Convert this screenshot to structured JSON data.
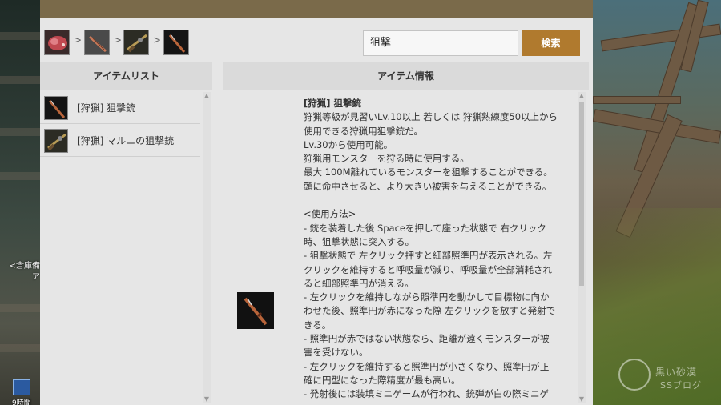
{
  "hud": {
    "side_text": "<倉庫備 ア",
    "time_text": "9時間"
  },
  "watermark": {
    "line1": "黒い砂漠",
    "line2": "SSブログ"
  },
  "breadcrumb": {
    "items": [
      {
        "icon": "meat-icon"
      },
      {
        "icon": "rifle-category-icon"
      },
      {
        "icon": "marni-rifle-icon"
      },
      {
        "icon": "sniper-rifle-icon"
      }
    ],
    "separator": ">"
  },
  "search": {
    "value": "狙撃",
    "button_label": "検索"
  },
  "list_panel": {
    "header": "アイテムリスト",
    "items": [
      {
        "label": "[狩猟] 狙撃銃",
        "icon": "sniper-rifle-icon"
      },
      {
        "label": "[狩猟] マルニの狙撃銃",
        "icon": "marni-rifle-icon"
      }
    ]
  },
  "info_panel": {
    "header": "アイテム情報",
    "title": "[狩猟] 狙撃銃",
    "lines": [
      "狩猟等級が見習いLv.10以上 若しくは 狩猟熟練度50以上から",
      "使用できる狩猟用狙撃銃だ。",
      "Lv.30から使用可能。",
      "狩猟用モンスターを狩る時に使用する。",
      "最大 100M離れているモンスターを狙撃することができる。",
      "頭に命中させると、より大きい被害を与えることができる。",
      "",
      "<使用方法>",
      "- 銃を装着した後 Spaceを押して座った状態で 右クリック",
      "時、狙撃状態に突入する。",
      "- 狙撃状態で 左クリック押すと細部照準円が表示される。左",
      "クリックを維持すると呼吸量が減り、呼吸量が全部消耗され",
      "ると細部照準円が消える。",
      "- 左クリックを維持しながら照準円を動かして目標物に向か",
      "わせた後、照準円が赤になった際 左クリックを放すと発射で",
      "きる。",
      "- 照準円が赤ではない状態なら、距離が遠くモンスターが被",
      "害を受けない。",
      "- 左クリックを維持すると照準円が小さくなり、照準円が正",
      "確に円型になった際精度が最も高い。",
      "- 発射後には装填ミニゲームが行われ、銃弾が白の際ミニゲ"
    ]
  },
  "colors": {
    "title_bar": "#7a6a4a",
    "accent_button": "#b07a2e",
    "panel_bg": "#e6e6e6",
    "header_bg": "#dadada"
  }
}
